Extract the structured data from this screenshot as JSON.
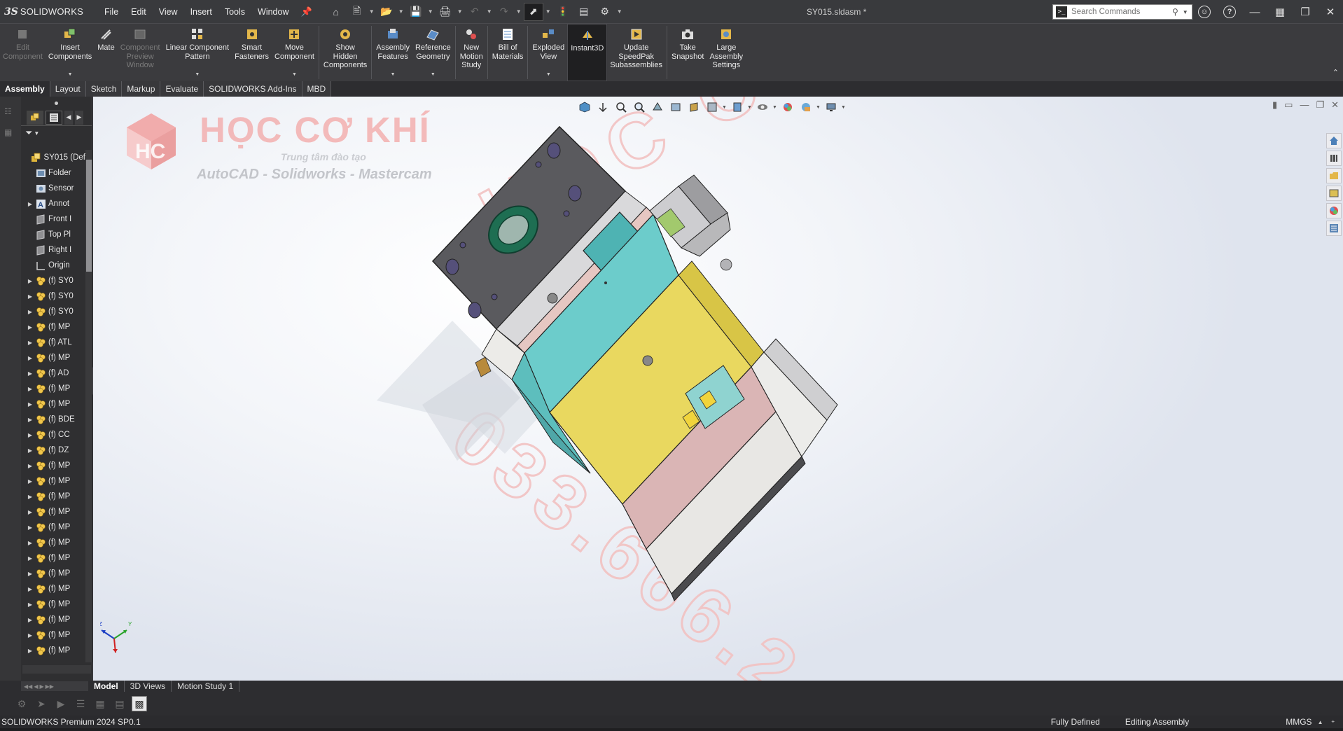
{
  "app": {
    "logo_prefix": "3S",
    "logo_name": "SOLIDWORKS",
    "document_title": "SY015.sldasm *"
  },
  "menu": [
    "File",
    "Edit",
    "View",
    "Insert",
    "Tools",
    "Window"
  ],
  "search": {
    "placeholder": "Search Commands"
  },
  "ribbon": [
    {
      "label": "Edit\nComponent",
      "icon": "edit-component-icon",
      "enabled": false,
      "dropdown": false
    },
    {
      "label": "Insert\nComponents",
      "icon": "insert-components-icon",
      "enabled": true,
      "dropdown": true
    },
    {
      "label": "Mate",
      "icon": "mate-icon",
      "enabled": true,
      "dropdown": false
    },
    {
      "label": "Component\nPreview\nWindow",
      "icon": "component-preview-icon",
      "enabled": false,
      "dropdown": false
    },
    {
      "label": "Linear Component\nPattern",
      "icon": "linear-pattern-icon",
      "enabled": true,
      "dropdown": true
    },
    {
      "label": "Smart\nFasteners",
      "icon": "smart-fasteners-icon",
      "enabled": true,
      "dropdown": false
    },
    {
      "label": "Move\nComponent",
      "icon": "move-component-icon",
      "enabled": true,
      "dropdown": true
    },
    {
      "label": "Show\nHidden\nComponents",
      "icon": "show-hidden-icon",
      "enabled": true,
      "dropdown": false
    },
    {
      "label": "Assembly\nFeatures",
      "icon": "assembly-features-icon",
      "enabled": true,
      "dropdown": true
    },
    {
      "label": "Reference\nGeometry",
      "icon": "reference-geometry-icon",
      "enabled": true,
      "dropdown": true
    },
    {
      "label": "New\nMotion\nStudy",
      "icon": "motion-study-icon",
      "enabled": true,
      "dropdown": false
    },
    {
      "label": "Bill of\nMaterials",
      "icon": "bill-of-materials-icon",
      "enabled": true,
      "dropdown": false
    },
    {
      "label": "Exploded\nView",
      "icon": "exploded-view-icon",
      "enabled": true,
      "dropdown": true
    },
    {
      "label": "Instant3D",
      "icon": "instant3d-icon",
      "enabled": true,
      "dropdown": false,
      "active": true
    },
    {
      "label": "Update\nSpeedPak\nSubassemblies",
      "icon": "speedpak-icon",
      "enabled": true,
      "dropdown": false
    },
    {
      "label": "Take\nSnapshot",
      "icon": "snapshot-icon",
      "enabled": true,
      "dropdown": false
    },
    {
      "label": "Large\nAssembly\nSettings",
      "icon": "large-assembly-icon",
      "enabled": true,
      "dropdown": false
    }
  ],
  "tabs": [
    "Assembly",
    "Layout",
    "Sketch",
    "Markup",
    "Evaluate",
    "SOLIDWORKS Add-Ins",
    "MBD"
  ],
  "active_tab": "Assembly",
  "tree": [
    {
      "label": "SY015 (Def",
      "icon": "assembly-icon",
      "expand": false,
      "indent": 0
    },
    {
      "label": "Folder",
      "icon": "folder-icon",
      "expand": false,
      "indent": 1
    },
    {
      "label": "Sensor",
      "icon": "sensor-icon",
      "expand": false,
      "indent": 1
    },
    {
      "label": "Annot",
      "icon": "annotation-icon",
      "expand": true,
      "indent": 1
    },
    {
      "label": "Front I",
      "icon": "plane-icon",
      "expand": false,
      "indent": 1
    },
    {
      "label": "Top Pl",
      "icon": "plane-icon",
      "expand": false,
      "indent": 1
    },
    {
      "label": "Right I",
      "icon": "plane-icon",
      "expand": false,
      "indent": 1
    },
    {
      "label": "Origin",
      "icon": "origin-icon",
      "expand": false,
      "indent": 1
    },
    {
      "label": "(f) SY0",
      "icon": "part-icon",
      "expand": true,
      "indent": 1
    },
    {
      "label": "(f) SY0",
      "icon": "part-icon",
      "expand": true,
      "indent": 1
    },
    {
      "label": "(f) SY0",
      "icon": "part-icon",
      "expand": true,
      "indent": 1
    },
    {
      "label": "(f) MP",
      "icon": "part-icon",
      "expand": true,
      "indent": 1
    },
    {
      "label": "(f) ATL",
      "icon": "part-icon",
      "expand": true,
      "indent": 1
    },
    {
      "label": "(f) MP",
      "icon": "part-icon",
      "expand": true,
      "indent": 1
    },
    {
      "label": "(f) AD",
      "icon": "part-icon",
      "expand": true,
      "indent": 1
    },
    {
      "label": "(f) MP",
      "icon": "part-icon",
      "expand": true,
      "indent": 1
    },
    {
      "label": "(f) MP",
      "icon": "part-icon",
      "expand": true,
      "indent": 1
    },
    {
      "label": "(f) BDE",
      "icon": "part-icon",
      "expand": true,
      "indent": 1
    },
    {
      "label": "(f) CC",
      "icon": "part-icon",
      "expand": true,
      "indent": 1
    },
    {
      "label": "(f) DZ",
      "icon": "part-icon",
      "expand": true,
      "indent": 1
    },
    {
      "label": "(f) MP",
      "icon": "part-icon",
      "expand": true,
      "indent": 1
    },
    {
      "label": "(f) MP",
      "icon": "part-icon",
      "expand": true,
      "indent": 1
    },
    {
      "label": "(f) MP",
      "icon": "part-icon",
      "expand": true,
      "indent": 1
    },
    {
      "label": "(f) MP",
      "icon": "part-icon",
      "expand": true,
      "indent": 1
    },
    {
      "label": "(f) MP",
      "icon": "part-icon",
      "expand": true,
      "indent": 1
    },
    {
      "label": "(f) MP",
      "icon": "part-icon",
      "expand": true,
      "indent": 1
    },
    {
      "label": "(f) MP",
      "icon": "part-icon",
      "expand": true,
      "indent": 1
    },
    {
      "label": "(f) MP",
      "icon": "part-icon",
      "expand": true,
      "indent": 1
    },
    {
      "label": "(f) MP",
      "icon": "part-icon",
      "expand": true,
      "indent": 1
    },
    {
      "label": "(f) MP",
      "icon": "part-icon",
      "expand": true,
      "indent": 1
    },
    {
      "label": "(f) MP",
      "icon": "part-icon",
      "expand": true,
      "indent": 1
    },
    {
      "label": "(f) MP",
      "icon": "part-icon",
      "expand": true,
      "indent": 1
    },
    {
      "label": "(f) MP",
      "icon": "part-icon",
      "expand": true,
      "indent": 1
    }
  ],
  "watermark": {
    "title": "HỌC CƠ KHÍ",
    "subtitle1": "Trung tâm đào tạo",
    "subtitle2": "AutoCAD - Solidworks - Mastercam",
    "diagonal": "HỌC CƠ KHÍ",
    "phone": "033.666.2"
  },
  "bottom_tabs": [
    "Model",
    "3D Views",
    "Motion Study 1"
  ],
  "active_bottom_tab": "Model",
  "status": {
    "product": "SOLIDWORKS Premium 2024 SP0.1",
    "definition": "Fully Defined",
    "mode": "Editing Assembly",
    "units": "MMGS"
  },
  "colors": {
    "accent_yellow": "#e2d25a",
    "cyan_plate": "#5fb8b6",
    "gray_plate": "#5b5b5f",
    "pink_plate": "#d9b2b2"
  }
}
